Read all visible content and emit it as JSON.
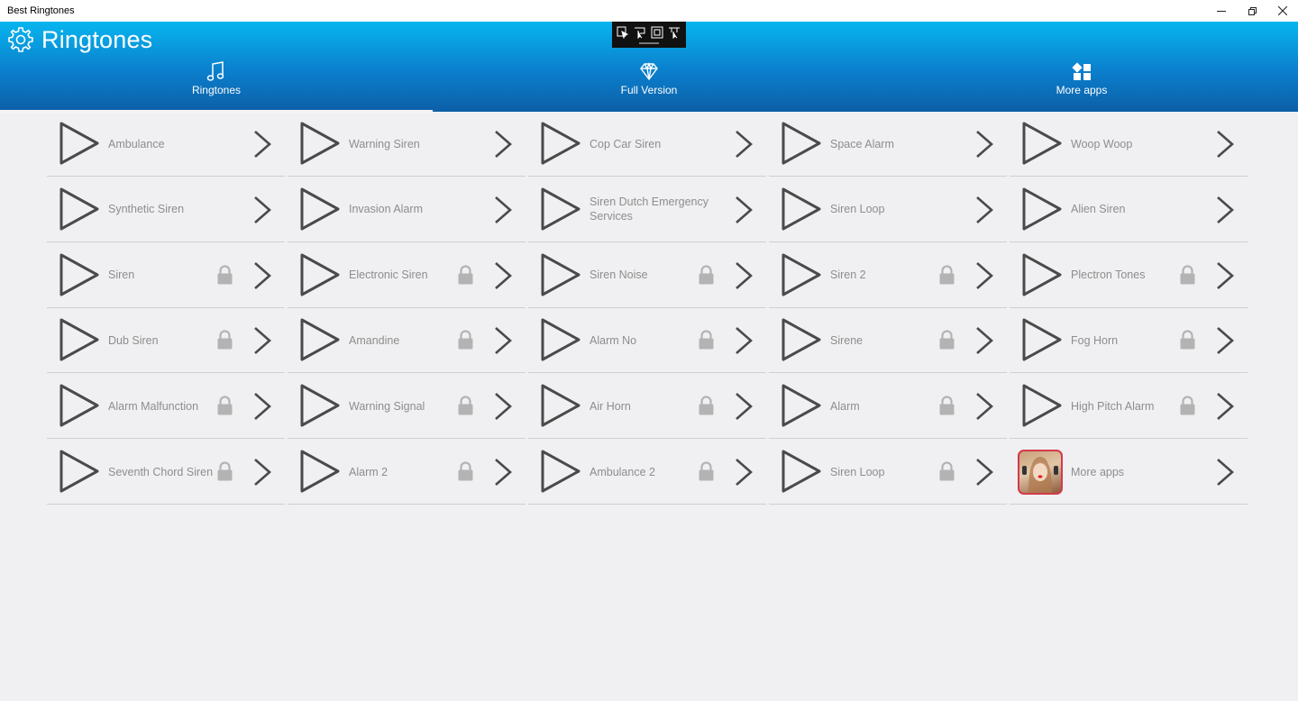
{
  "window": {
    "title": "Best Ringtones",
    "controls": [
      "minimize",
      "restore",
      "close"
    ]
  },
  "header": {
    "app_title": "Ringtones",
    "settings_icon": "gear-icon",
    "colors": {
      "gradient_top": "#07b6ee",
      "gradient_bottom": "#0c5fa6",
      "text": "#ffffff"
    },
    "debug_toolbar_icons": [
      "select-element-icon",
      "pointer-select-icon",
      "layout-bounds-icon",
      "track-focus-icon"
    ]
  },
  "nav": {
    "tabs": [
      {
        "label": "Ringtones",
        "icon": "music-note-icon",
        "active": true
      },
      {
        "label": "Full Version",
        "icon": "diamond-icon",
        "active": false
      },
      {
        "label": "More apps",
        "icon": "apps-grid-icon",
        "active": false
      }
    ]
  },
  "ringtones": {
    "text_color": "#8d8d8d",
    "icon_color": "#4a4a4a",
    "lock_color": "#b3b3b3",
    "items": [
      {
        "name": "Ambulance",
        "locked": false
      },
      {
        "name": "Warning Siren",
        "locked": false
      },
      {
        "name": "Cop Car Siren",
        "locked": false
      },
      {
        "name": "Space Alarm",
        "locked": false
      },
      {
        "name": "Woop Woop",
        "locked": false
      },
      {
        "name": "Synthetic Siren",
        "locked": false
      },
      {
        "name": "Invasion Alarm",
        "locked": false
      },
      {
        "name": "Siren Dutch Emergency Services",
        "locked": false
      },
      {
        "name": "Siren Loop",
        "locked": false
      },
      {
        "name": "Alien Siren",
        "locked": false
      },
      {
        "name": "Siren",
        "locked": true
      },
      {
        "name": "Electronic Siren",
        "locked": true
      },
      {
        "name": "Siren Noise",
        "locked": true
      },
      {
        "name": "Siren 2",
        "locked": true
      },
      {
        "name": "Plectron Tones",
        "locked": true
      },
      {
        "name": "Dub Siren",
        "locked": true
      },
      {
        "name": "Amandine",
        "locked": true
      },
      {
        "name": "Alarm No",
        "locked": true
      },
      {
        "name": "Sirene",
        "locked": true
      },
      {
        "name": "Fog Horn",
        "locked": true
      },
      {
        "name": "Alarm Malfunction",
        "locked": true
      },
      {
        "name": "Warning Signal",
        "locked": true
      },
      {
        "name": "Air Horn",
        "locked": true
      },
      {
        "name": "Alarm",
        "locked": true
      },
      {
        "name": "High Pitch Alarm",
        "locked": true
      },
      {
        "name": "Seventh Chord Siren",
        "locked": true
      },
      {
        "name": "Alarm 2",
        "locked": true
      },
      {
        "name": "Ambulance 2",
        "locked": true
      },
      {
        "name": "Siren Loop",
        "locked": true
      },
      {
        "name": "More apps",
        "locked": false,
        "kind": "more-apps"
      }
    ]
  }
}
